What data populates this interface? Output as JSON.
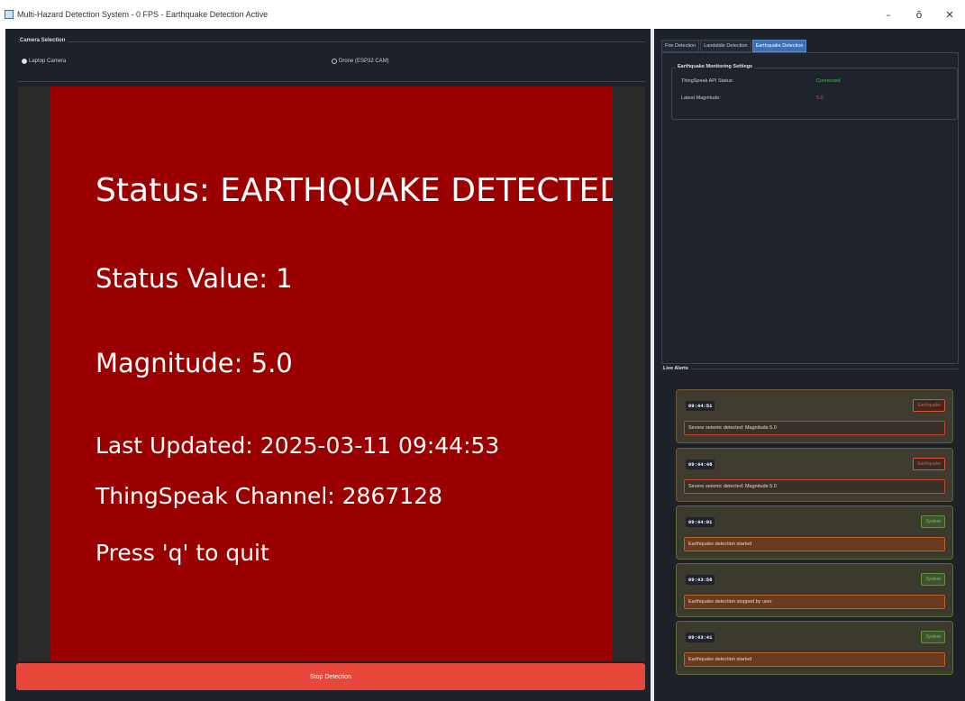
{
  "window": {
    "title": "Multi-Hazard Detection System - 0 FPS - Earthquake Detection Active",
    "minimize": "–",
    "maximize": "ō",
    "close": "✕"
  },
  "camera_selection": {
    "label": "Camera Selection",
    "options": [
      "Laptop Camera",
      "Drone (ESP32 CAM)"
    ],
    "selected": "Laptop Camera"
  },
  "video": {
    "lines": [
      "Status: EARTHQUAKE DETECTED",
      "Status Value: 1",
      "Magnitude: 5.0",
      "Last Updated: 2025-03-11 09:44:53",
      "ThingSpeak Channel: 2867128",
      "Press 'q' to quit"
    ]
  },
  "stop_button": {
    "label": "Stop Detection"
  },
  "tabs": [
    {
      "label": "Fire Detection",
      "active": false
    },
    {
      "label": "Landslide Detection",
      "active": false
    },
    {
      "label": "Earthquake Detection",
      "active": true
    }
  ],
  "settings": {
    "group_label": "Earthquake Monitoring Settings",
    "rows": [
      {
        "label": "ThingSpeak API Status:",
        "value": "Connected",
        "color": "#3fbf4f"
      },
      {
        "label": "Latest Magnitude:",
        "value": "5.0",
        "color": "#e0533b"
      }
    ]
  },
  "alerts": {
    "label": "Live Alerts",
    "items": [
      {
        "time": "09:44:51",
        "badge": "Earthquake",
        "type": "eq",
        "message": "Severe seismic detected: Magnitude 5.0"
      },
      {
        "time": "09:44:48",
        "badge": "Earthquake",
        "type": "eq",
        "message": "Severe seismic detected: Magnitude 5.0"
      },
      {
        "time": "09:44:01",
        "badge": "System",
        "type": "sys",
        "message": "Earthquake detection started"
      },
      {
        "time": "09:43:58",
        "badge": "System",
        "type": "sys",
        "message": "Earthquake detection stopped by user"
      },
      {
        "time": "09:43:41",
        "badge": "System",
        "type": "sys",
        "message": "Earthquake detection started"
      }
    ]
  },
  "colors": {
    "video_bg": "#9b0000",
    "stop_button": "#e8473b",
    "active_tab": "#3d6fb3",
    "connected": "#3fbf4f",
    "magnitude": "#e0533b"
  }
}
